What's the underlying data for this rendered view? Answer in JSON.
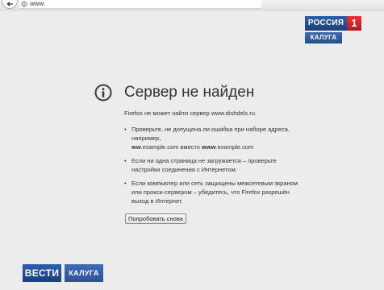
{
  "browser": {
    "url": "www."
  },
  "error_page": {
    "title": "Сервер не найден",
    "subtitle": "Firefox не может найти сервер www.dishdels.ru.",
    "suggestions": [
      {
        "line1": "Проверьте, не допущена ли ошибка при наборе адреса, например,",
        "line2_pre": "",
        "line2_bold1": "ww",
        "line2_mid": ".example.com вместо ",
        "line2_bold2": "www",
        "line2_post": ".example.com"
      },
      {
        "text": "Если ни одна страница не загружается – проверьте настройки соединения с Интернетом."
      },
      {
        "text": "Если компьютер или сеть защищены межсетевым экраном или прокси-сервером – убедитесь, что Firefox разрешён выход в Интернет."
      }
    ],
    "bullet": "•",
    "retry_label": "Попробовать снова"
  },
  "logo_top": {
    "channel": "РОССИЯ",
    "number": "1",
    "region": "КАЛУГА"
  },
  "logo_bottom": {
    "brand": "ВЕСТИ",
    "region": "КАЛУГА"
  },
  "icons": {
    "back": "back-arrow-icon",
    "site": "site-identity-icon",
    "info": "info-icon"
  },
  "colors": {
    "page_background": "#ececec",
    "brand_blue": "#1d3f7e",
    "brand_red": "#b11a20"
  }
}
